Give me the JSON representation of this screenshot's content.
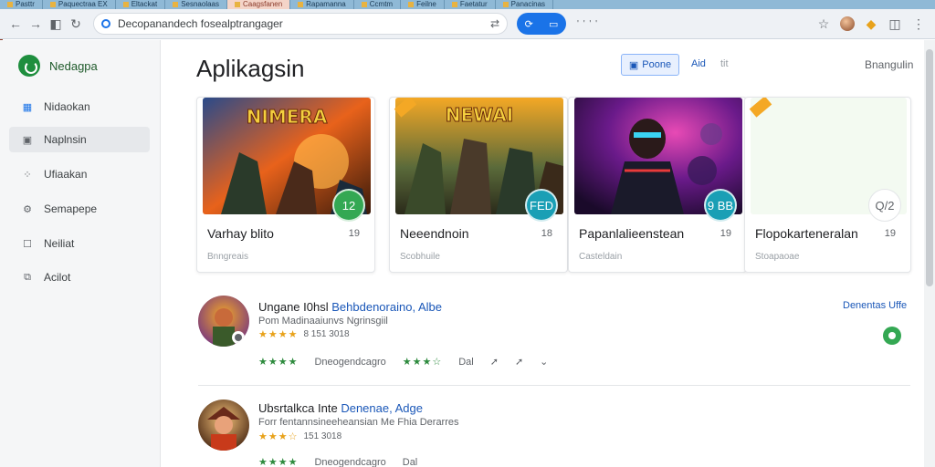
{
  "browser": {
    "tabs": [
      {
        "label": "Pasttr"
      },
      {
        "label": "Paquectraa EX"
      },
      {
        "label": "Eltackat"
      },
      {
        "label": "Sesnaolaas"
      },
      {
        "label": "Caagsfanen"
      },
      {
        "label": "Rapamanna"
      },
      {
        "label": "Ccmtm"
      },
      {
        "label": "Feilne"
      },
      {
        "label": "Faetatur"
      },
      {
        "label": "Panacinas"
      }
    ],
    "url": "Decopanandech fosealptrangager",
    "toolbar_dots": "' ' ' '"
  },
  "sidebar": {
    "brand": "Nedagpa",
    "items": [
      {
        "label": "Nidaokan",
        "icon": "grid-icon"
      },
      {
        "label": "Naplnsin",
        "icon": "square-icon"
      },
      {
        "label": "Ufiaakan",
        "icon": "apps-icon"
      },
      {
        "label": "Semapepe",
        "icon": "gear-icon"
      },
      {
        "label": "Neiliat",
        "icon": "checkbox-icon"
      },
      {
        "label": "Acilot",
        "icon": "box-icon"
      }
    ]
  },
  "main": {
    "title": "Aplikagsin",
    "filter_button": "Poone",
    "filter_extra": "Aid",
    "filter_extra2": "tit",
    "top_right": "Bnangulin",
    "cards": [
      {
        "title": "Varhay blito",
        "count": "19",
        "sub": "Bnngreais",
        "badge": "12",
        "badge_color": "#34a853",
        "art_text": "NIMERA"
      },
      {
        "title": "Neeendnoin",
        "count": "18",
        "sub": "Scobhuile",
        "badge": "FED",
        "badge_color": "#1a9fb5",
        "art_text": "NEWAI"
      },
      {
        "title": "Papanlalieenstean",
        "count": "19",
        "sub": "Casteldain",
        "badge": "9 BB",
        "badge_color": "#1a9fb5",
        "art_text": ""
      },
      {
        "title": "Flopokarteneralan",
        "count": "19",
        "sub": "Stoapaoae",
        "badge": "Q/2",
        "badge_color": "#ffffff",
        "art_text": ""
      }
    ],
    "rows": [
      {
        "title": "Ungane I0hsl",
        "title_highlight": "Behbdenoraino, Albe",
        "desc": "Pom  Madinaaiunvs Ngrinsgiil",
        "stars": "★★★★",
        "rating_text": "8   151 3018",
        "meta_stars_a": "★★★★",
        "meta_a": "Dneogendcagro",
        "meta_stars_b": "★★★☆",
        "meta_b": "Dal",
        "link": "Denentas Uffe"
      },
      {
        "title": "Ubsrtalkca Inte",
        "title_highlight": "Denenae, Adge",
        "desc": "Forr fentannsineeheansian Me Fhia Derarres",
        "stars": "★★★☆",
        "rating_text": "  151 3018",
        "meta_stars_a": "★★★★",
        "meta_a": "Dneogendcagro",
        "meta_stars_b": "",
        "meta_b": "Dal",
        "link": ""
      }
    ]
  }
}
